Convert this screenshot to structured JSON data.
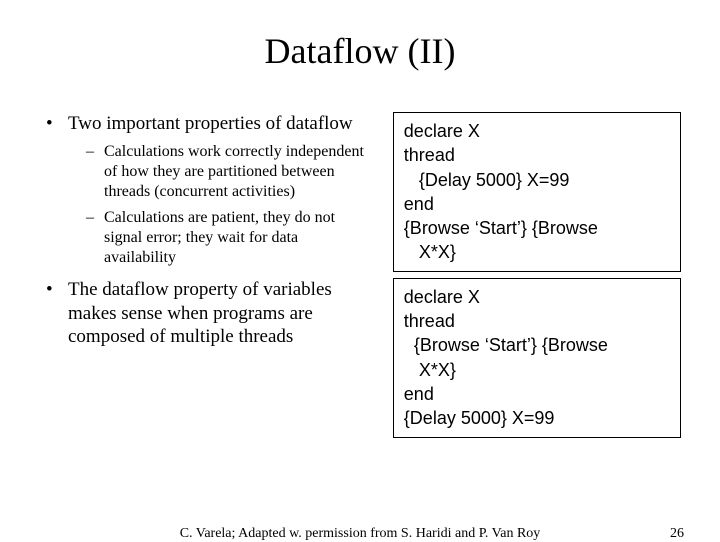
{
  "title": "Dataflow (II)",
  "bullets": {
    "b1": {
      "text": "Two important properties of dataflow",
      "sub1": "Calculations work correctly independent of how they are partitioned between threads (concurrent activities)",
      "sub2": "Calculations are patient, they do not signal error; they wait for data availability"
    },
    "b2": {
      "text": "The dataflow property of variables makes sense when programs are composed of multiple threads"
    }
  },
  "code": {
    "box1": "declare X\nthread\n   {Delay 5000} X=99\nend\n{Browse ‘Start’} {Browse\n   X*X}",
    "box2": "declare X\nthread\n  {Browse ‘Start’} {Browse\n   X*X}\nend\n{Delay 5000} X=99"
  },
  "footer": {
    "credit": "C. Varela;  Adapted w. permission from S. Haridi and P. Van Roy",
    "page": "26"
  }
}
